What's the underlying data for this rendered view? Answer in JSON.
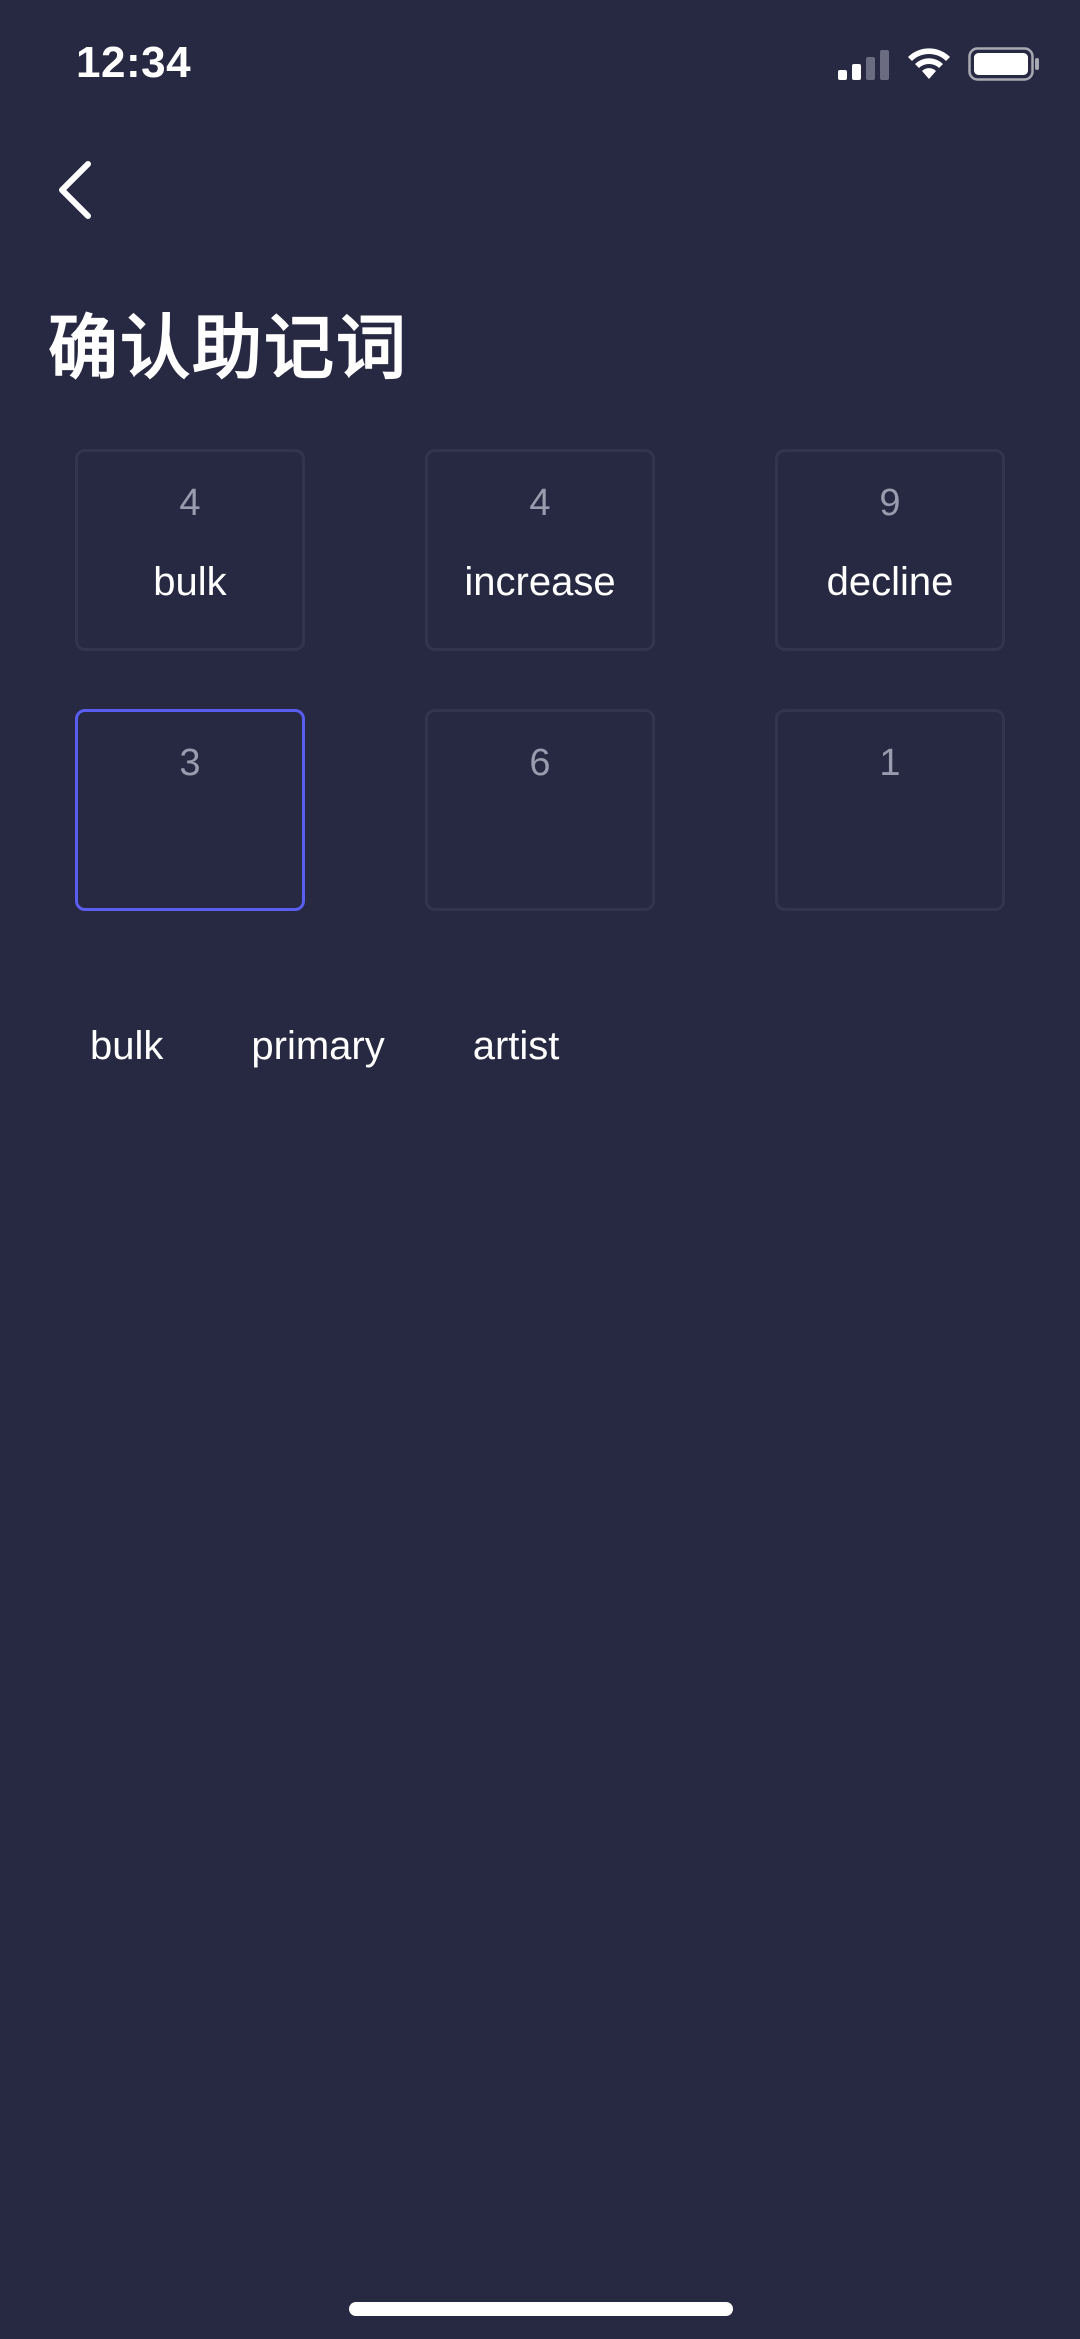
{
  "status_bar": {
    "time": "12:34"
  },
  "header": {
    "back_icon": "chevron-left-icon",
    "title": "确认助记词"
  },
  "slots": [
    {
      "index": "4",
      "word": "bulk",
      "active": false
    },
    {
      "index": "4",
      "word": "increase",
      "active": false
    },
    {
      "index": "9",
      "word": "decline",
      "active": false
    },
    {
      "index": "3",
      "word": "",
      "active": true
    },
    {
      "index": "6",
      "word": "",
      "active": false
    },
    {
      "index": "1",
      "word": "",
      "active": false
    }
  ],
  "word_options": [
    "bulk",
    "primary",
    "artist"
  ],
  "colors": {
    "background": "#272841",
    "slot_border": "#33354f",
    "active_border": "#5a5ef0",
    "index_text": "#9a9bae",
    "text": "#ffffff"
  }
}
